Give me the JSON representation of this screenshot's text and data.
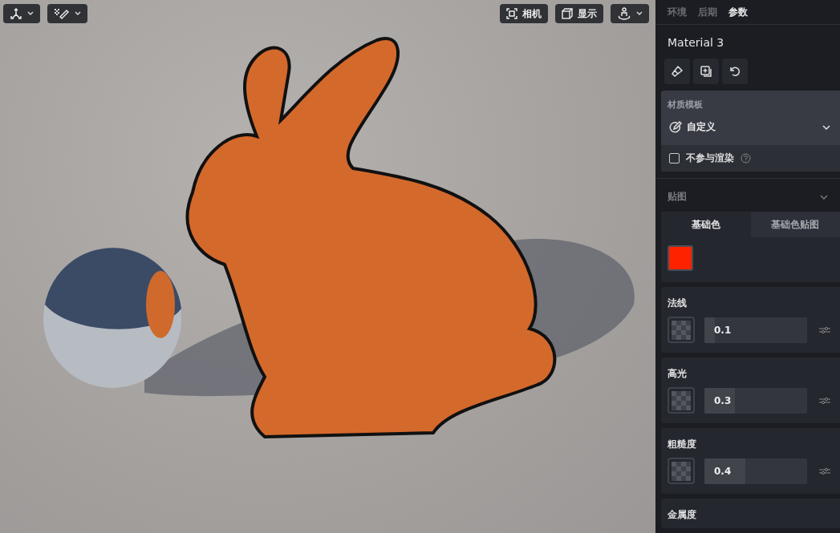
{
  "viewport": {
    "left_tools": [
      {
        "kind": "axes",
        "caret": true
      },
      {
        "kind": "brush",
        "caret": true
      }
    ],
    "right_tools": [
      {
        "kind": "camera",
        "label": "相机",
        "caret": false
      },
      {
        "kind": "display",
        "label": "显示",
        "caret": false
      },
      {
        "kind": "figure",
        "caret": true
      }
    ]
  },
  "panel": {
    "tabs": [
      {
        "label": "环境",
        "selected": false
      },
      {
        "label": "后期",
        "selected": false
      },
      {
        "label": "参数",
        "selected": true
      }
    ],
    "material_name": "Material 3",
    "actions": [
      {
        "kind": "brush"
      },
      {
        "kind": "duplicate"
      },
      {
        "kind": "reset"
      }
    ],
    "template": {
      "heading": "材质模板",
      "value": "自定义",
      "exclude_label": "不参与渲染",
      "exclude_checked": false
    },
    "maps": {
      "heading": "贴图",
      "expanded": true,
      "tabs": [
        {
          "label": "基础色",
          "selected": true
        },
        {
          "label": "基础色贴图",
          "selected": false
        }
      ],
      "color": "#ff2200"
    },
    "params": [
      {
        "kind": "slider",
        "label": "法线",
        "value": "0.1",
        "level": 0.1
      },
      {
        "kind": "slider",
        "label": "高光",
        "value": "0.3",
        "level": 0.3
      },
      {
        "kind": "slider",
        "label": "粗糙度",
        "value": "0.4",
        "level": 0.4
      },
      {
        "kind": "label",
        "label": "金属度"
      }
    ]
  }
}
